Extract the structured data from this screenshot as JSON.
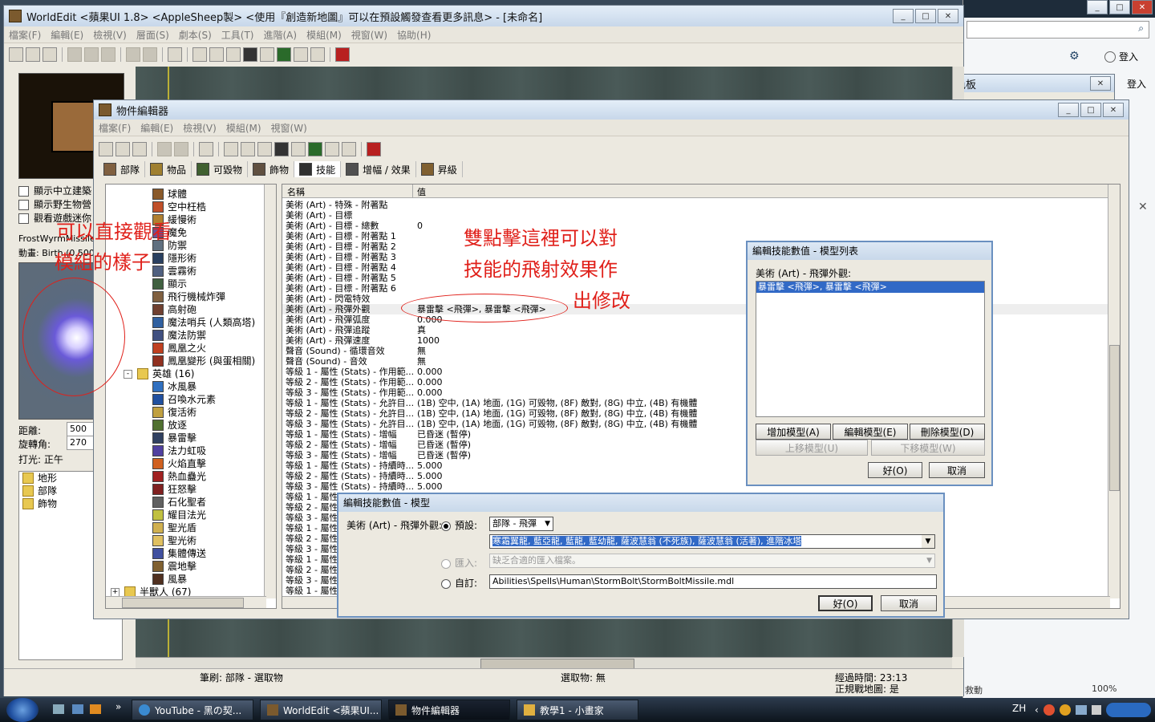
{
  "bg_window": {
    "login_label": "登入",
    "login_label2": "登入",
    "zoom": "100%",
    "status_right": "救動",
    "tool_palette_title": "工具色板"
  },
  "worldedit": {
    "title": "WorldEdit <蘋果UI 1.8> <AppleSheep製> <使用『創造新地圖』可以在預設觸發查看更多訊息> - [未命名]",
    "menus": [
      "檔案(F)",
      "編輯(E)",
      "檢視(V)",
      "層面(S)",
      "劇本(S)",
      "工具(T)",
      "進階(A)",
      "模組(M)",
      "視窗(W)",
      "協助(H)"
    ],
    "checkboxes": [
      "顯示中立建築",
      "顯示野生物營",
      "觀看遊戲迷你"
    ],
    "model_name": "FrostWyrmMissile",
    "anim_label": "動畫: Birth (0.500",
    "dist_label": "距離:",
    "dist_value": "500",
    "rot_label": "旋轉角:",
    "rot_value": "270",
    "light_label": "打光: 正午",
    "tree": [
      "地形",
      "部隊",
      "飾物"
    ],
    "status_brush": "筆刷: 部隊 - 選取物",
    "status_sel": "選取物: 無",
    "status_time": "經過時間: 23:13",
    "status_map": "正規戰地圖: 是"
  },
  "object_editor": {
    "title": "物件編輯器",
    "menus": [
      "檔案(F)",
      "編輯(E)",
      "檢視(V)",
      "模組(M)",
      "視窗(W)"
    ],
    "tabs": [
      "部隊",
      "物品",
      "可毀物",
      "飾物",
      "技能",
      "增幅 / 效果",
      "昇級"
    ],
    "tree_items": [
      {
        "label": "球體",
        "color": "#8a5a2a"
      },
      {
        "label": "空中枉梏",
        "color": "#c0502a"
      },
      {
        "label": "緩慢術",
        "color": "#b08030"
      },
      {
        "label": "魔免",
        "color": "#705090"
      },
      {
        "label": "防禦",
        "color": "#607080"
      },
      {
        "label": "隱形術",
        "color": "#2a4060"
      },
      {
        "label": "雲霧術",
        "color": "#506080"
      },
      {
        "label": "顯示",
        "color": "#406040"
      },
      {
        "label": "飛行機械炸彈",
        "color": "#806040"
      },
      {
        "label": "高射砲",
        "color": "#704030"
      },
      {
        "label": "魔法哨兵 (人類高塔)",
        "color": "#3060a0"
      },
      {
        "label": "魔法防禦",
        "color": "#405080"
      },
      {
        "label": "鳳凰之火",
        "color": "#c04020"
      },
      {
        "label": "鳳凰變形 (與蛋相關)",
        "color": "#903020"
      }
    ],
    "hero_folder": "英雄 (16)",
    "hero_items": [
      {
        "label": "冰風暴",
        "color": "#3070c0"
      },
      {
        "label": "召喚水元素",
        "color": "#2050a0"
      },
      {
        "label": "復活術",
        "color": "#c0a040"
      },
      {
        "label": "放逐",
        "color": "#507030"
      },
      {
        "label": "暴雷擊",
        "color": "#304060"
      },
      {
        "label": "法力虹吸",
        "color": "#5040a0"
      },
      {
        "label": "火焰直擊",
        "color": "#d06020"
      },
      {
        "label": "熱血蠱光",
        "color": "#a02020"
      },
      {
        "label": "狂怒擊",
        "color": "#802020"
      },
      {
        "label": "石化聖者",
        "color": "#606060"
      },
      {
        "label": "耀目法光",
        "color": "#c0c040"
      },
      {
        "label": "聖光盾",
        "color": "#d0b050"
      },
      {
        "label": "聖光術",
        "color": "#e0c060"
      },
      {
        "label": "集體傳送",
        "color": "#4050a0"
      },
      {
        "label": "震地擊",
        "color": "#806030"
      },
      {
        "label": "風暴",
        "color": "#503020"
      }
    ],
    "orc_folder": "半獸人 (67)",
    "col_name": "名稱",
    "col_value": "值",
    "rows": [
      {
        "name": "美術 (Art) - 特殊 - 附著點",
        "value": ""
      },
      {
        "name": "美術 (Art) - 目標",
        "value": ""
      },
      {
        "name": "美術 (Art) - 目標 - 總數",
        "value": "0"
      },
      {
        "name": "美術 (Art) - 目標 - 附著點 1",
        "value": ""
      },
      {
        "name": "美術 (Art) - 目標 - 附著點 2",
        "value": ""
      },
      {
        "name": "美術 (Art) - 目標 - 附著點 3",
        "value": ""
      },
      {
        "name": "美術 (Art) - 目標 - 附著點 4",
        "value": ""
      },
      {
        "name": "美術 (Art) - 目標 - 附著點 5",
        "value": ""
      },
      {
        "name": "美術 (Art) - 目標 - 附著點 6",
        "value": ""
      },
      {
        "name": "美術 (Art) - 閃電特效",
        "value": ""
      },
      {
        "name": "美術 (Art) - 飛彈外觀",
        "value": "暴雷擊 <飛彈>, 暴雷擊 <飛彈>"
      },
      {
        "name": "美術 (Art) - 飛彈弧度",
        "value": "0.000"
      },
      {
        "name": "美術 (Art) - 飛彈追蹤",
        "value": "真"
      },
      {
        "name": "美術 (Art) - 飛彈速度",
        "value": "1000"
      },
      {
        "name": "聲音 (Sound) - 循環音效",
        "value": "無"
      },
      {
        "name": "聲音 (Sound) - 音效",
        "value": "無"
      },
      {
        "name": "等級 1 - 屬性 (Stats) - 作用範...",
        "value": "0.000"
      },
      {
        "name": "等級 2 - 屬性 (Stats) - 作用範...",
        "value": "0.000"
      },
      {
        "name": "等級 3 - 屬性 (Stats) - 作用範...",
        "value": "0.000"
      },
      {
        "name": "等級 1 - 屬性 (Stats) - 允許目...",
        "value": "(1B) 空中, (1A) 地面, (1G) 可毀物, (8F) 敵對, (8G) 中立, (4B) 有機體"
      },
      {
        "name": "等級 2 - 屬性 (Stats) - 允許目...",
        "value": "(1B) 空中, (1A) 地面, (1G) 可毀物, (8F) 敵對, (8G) 中立, (4B) 有機體"
      },
      {
        "name": "等級 3 - 屬性 (Stats) - 允許目...",
        "value": "(1B) 空中, (1A) 地面, (1G) 可毀物, (8F) 敵對, (8G) 中立, (4B) 有機體"
      },
      {
        "name": "等級 1 - 屬性 (Stats) - 增幅",
        "value": "已昏迷 (暫停)"
      },
      {
        "name": "等級 2 - 屬性 (Stats) - 增幅",
        "value": "已昏迷 (暫停)"
      },
      {
        "name": "等級 3 - 屬性 (Stats) - 增幅",
        "value": "已昏迷 (暫停)"
      },
      {
        "name": "等級 1 - 屬性 (Stats) - 持續時...",
        "value": "5.000"
      },
      {
        "name": "等級 2 - 屬性 (Stats) - 持續時...",
        "value": "5.000"
      },
      {
        "name": "等級 3 - 屬性 (Stats) - 持續時...",
        "value": "5.000"
      },
      {
        "name": "等級 1 - 屬性",
        "value": ""
      },
      {
        "name": "等級 2 - 屬性",
        "value": ""
      },
      {
        "name": "等級 3 - 屬性",
        "value": ""
      },
      {
        "name": "等級 1 - 屬性",
        "value": ""
      },
      {
        "name": "等級 2 - 屬性",
        "value": ""
      },
      {
        "name": "等級 3 - 屬性",
        "value": ""
      },
      {
        "name": "等級 1 - 屬性",
        "value": ""
      },
      {
        "name": "等級 2 - 屬性",
        "value": ""
      },
      {
        "name": "等級 3 - 屬性",
        "value": ""
      },
      {
        "name": "等級 1 - 屬性",
        "value": ""
      }
    ]
  },
  "annotations": {
    "left_line1": "可以直接觀看",
    "left_line2": "模組的樣子",
    "right_line1": "雙點擊這裡可以對",
    "right_line2": "技能的飛射效果作",
    "right_line3": "出修改"
  },
  "model_list_dialog": {
    "title": "編輯技能數值 - 模型列表",
    "label": "美術 (Art) - 飛彈外觀:",
    "selected": "暴雷擊 <飛彈>, 暴雷擊 <飛彈>",
    "add": "增加模型(A)",
    "edit": "編輯模型(E)",
    "delete": "刪除模型(D)",
    "up": "上移模型(U)",
    "down": "下移模型(W)",
    "ok": "好(O)",
    "cancel": "取消"
  },
  "model_dialog": {
    "title": "編輯技能數值 - 模型",
    "label": "美術 (Art) - 飛彈外觀:",
    "preset": "預設:",
    "preset_value": "部隊 - 飛彈",
    "preset_list": "寒霜翼龍, 藍亞龍, 藍龍, 藍幼龍, 薩波慧翁 (不死族), 薩波慧翁 (活著), 進階冰塔",
    "import": "匯入:",
    "import_value": "缺乏合適的匯入檔案。",
    "custom": "自訂:",
    "custom_value": "Abilities\\Spells\\Human\\StormBolt\\StormBoltMissile.mdl",
    "ok": "好(O)",
    "cancel": "取消"
  },
  "taskbar": {
    "items": [
      "YouTube - 黑の契...",
      "WorldEdit <蘋果UI...",
      "物件編輯器",
      "教學1 - 小畫家"
    ],
    "lang": "ZH"
  }
}
